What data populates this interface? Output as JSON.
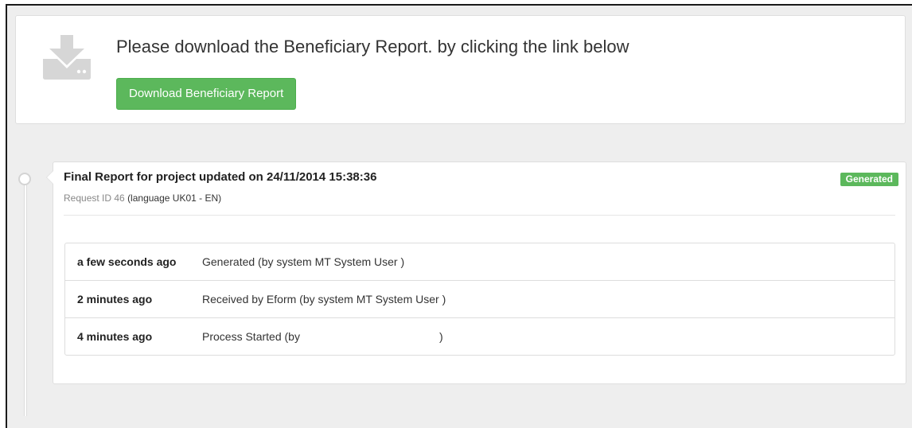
{
  "download": {
    "icon": "download-tray-icon",
    "title": "Please download the Beneficiary Report. by clicking the link below",
    "button_label": "Download Beneficiary Report"
  },
  "report": {
    "title": "Final Report for project updated on 24/11/2014 15:38:36",
    "status": "Generated",
    "request_id": "Request ID 46",
    "language": "(language UK01 - EN)"
  },
  "history": [
    {
      "time": "a few seconds ago",
      "description": "Generated (by system MT System User )"
    },
    {
      "time": "2 minutes ago",
      "description": "Received by Eform (by system MT System User )"
    },
    {
      "time": "4 minutes ago",
      "description": "Process Started (by                                             )"
    }
  ],
  "colors": {
    "success": "#5cb85c",
    "background": "#eeeeee",
    "panel": "#ffffff",
    "icon": "#d6d6d6"
  }
}
